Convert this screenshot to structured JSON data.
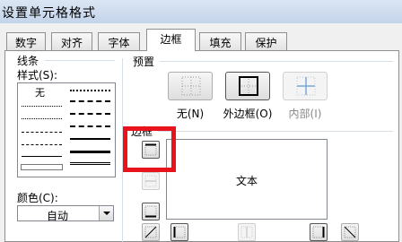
{
  "window": {
    "title": "设置单元格格式"
  },
  "tabs": [
    {
      "label": "数字",
      "active": false
    },
    {
      "label": "对齐",
      "active": false
    },
    {
      "label": "字体",
      "active": false
    },
    {
      "label": "边框",
      "active": true
    },
    {
      "label": "填充",
      "active": false
    },
    {
      "label": "保护",
      "active": false
    }
  ],
  "line_section": {
    "group_label": "线条",
    "style_label": "样式(S):",
    "none_label": "无",
    "color_label": "颜色(C):",
    "color_value": "自动"
  },
  "presets": {
    "group_label": "预置",
    "none": "无(N)",
    "outline": "外边框(O)",
    "inside": "内部(I)"
  },
  "border": {
    "group_label": "边框",
    "preview_text": "文本"
  },
  "colors": {
    "highlight": "#e8131b",
    "selection": "#3399ff"
  }
}
